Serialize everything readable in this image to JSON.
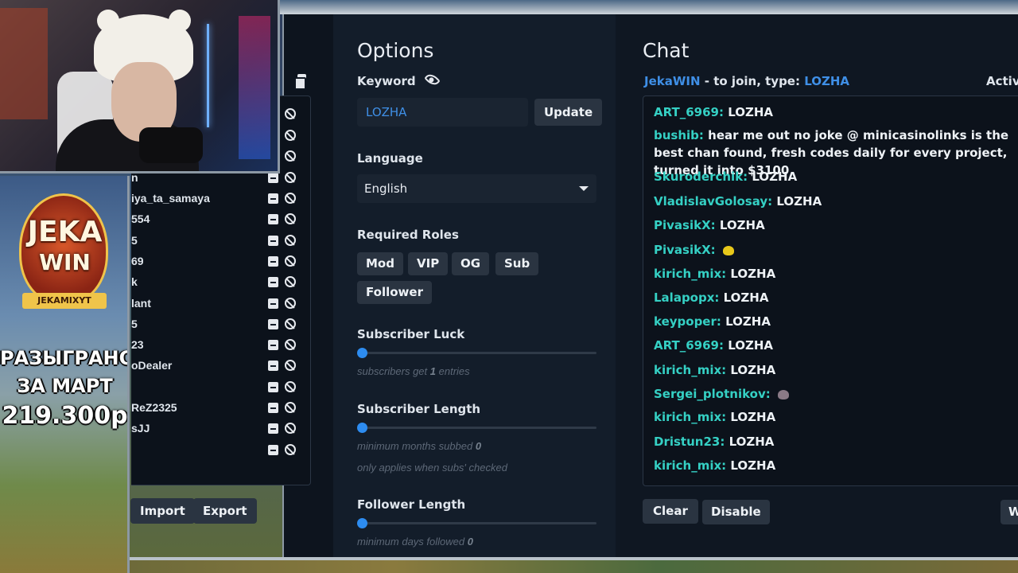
{
  "options": {
    "title": "Options",
    "keyword_label": "Keyword",
    "keyword_value": "LOZHA",
    "update_label": "Update",
    "language_label": "Language",
    "language_value": "English",
    "roles_label": "Required Roles",
    "roles": [
      "Mod",
      "VIP",
      "OG",
      "Sub",
      "Follower"
    ],
    "sub_luck_label": "Subscriber Luck",
    "sub_luck_hint_pre": "subscribers get",
    "sub_luck_value": "1",
    "sub_luck_hint_post": "entries",
    "sub_length_label": "Subscriber Length",
    "sub_length_hint_pre": "minimum months subbed",
    "sub_length_value": "0",
    "sub_length_note": "only applies when subs' checked",
    "follow_length_label": "Follower Length",
    "follow_length_hint_pre": "minimum days followed",
    "follow_length_value": "0"
  },
  "participants": {
    "visible_names": [
      "",
      "",
      "",
      "n",
      "iya_ta_samaya",
      "554",
      "5",
      "69",
      "k",
      "lant",
      "5",
      "23",
      "oDealer",
      "",
      "ReZ2325",
      "sJJ",
      ""
    ],
    "import_label": "Import",
    "export_label": "Export"
  },
  "chat": {
    "title": "Chat",
    "host": "JekaWIN",
    "join_text": "- to join, type:",
    "keyword": "LOZHA",
    "active_label": "Activ",
    "messages": [
      {
        "user": "ART_6969:",
        "text": "LOZHA"
      },
      {
        "user": "bushib:",
        "text": "hear me out no joke @ minicasinolinks is the best chan found, fresh codes daily for every project, turned it into $3100"
      },
      {
        "user": "Skuroderchik:",
        "text": "LOZHA"
      },
      {
        "user": "VladislavGolosay:",
        "text": "LOZHA"
      },
      {
        "user": "PivasikX:",
        "text": "LOZHA"
      },
      {
        "user": "PivasikX:",
        "text": ""
      },
      {
        "user": "kirich_mix:",
        "text": "LOZHA"
      },
      {
        "user": "Lalapopx:",
        "text": "LOZHA"
      },
      {
        "user": "keypoper:",
        "text": "LOZHA"
      },
      {
        "user": "ART_6969:",
        "text": "LOZHA"
      },
      {
        "user": "kirich_mix:",
        "text": "LOZHA"
      },
      {
        "user": "Sergei_plotnikov:",
        "text": ""
      },
      {
        "user": "kirich_mix:",
        "text": "LOZHA"
      },
      {
        "user": "Dristun23:",
        "text": "LOZHA"
      },
      {
        "user": "kirich_mix:",
        "text": "LOZHA"
      }
    ],
    "clear_label": "Clear",
    "disable_label": "Disable",
    "right_btn_label": "W"
  },
  "overlay": {
    "logo_line1": "JEKA",
    "logo_line2": "WIN",
    "logo_ribbon": "JEKAMIXYT",
    "promo_line1": "РАЗЫГРАНО",
    "promo_line2": "ЗА МАРТ",
    "promo_amount": "219.300р"
  },
  "colors": {
    "accent": "#3f8fe6",
    "username": "#35d0c4",
    "panel": "#131d2a",
    "button": "#2a3441"
  }
}
